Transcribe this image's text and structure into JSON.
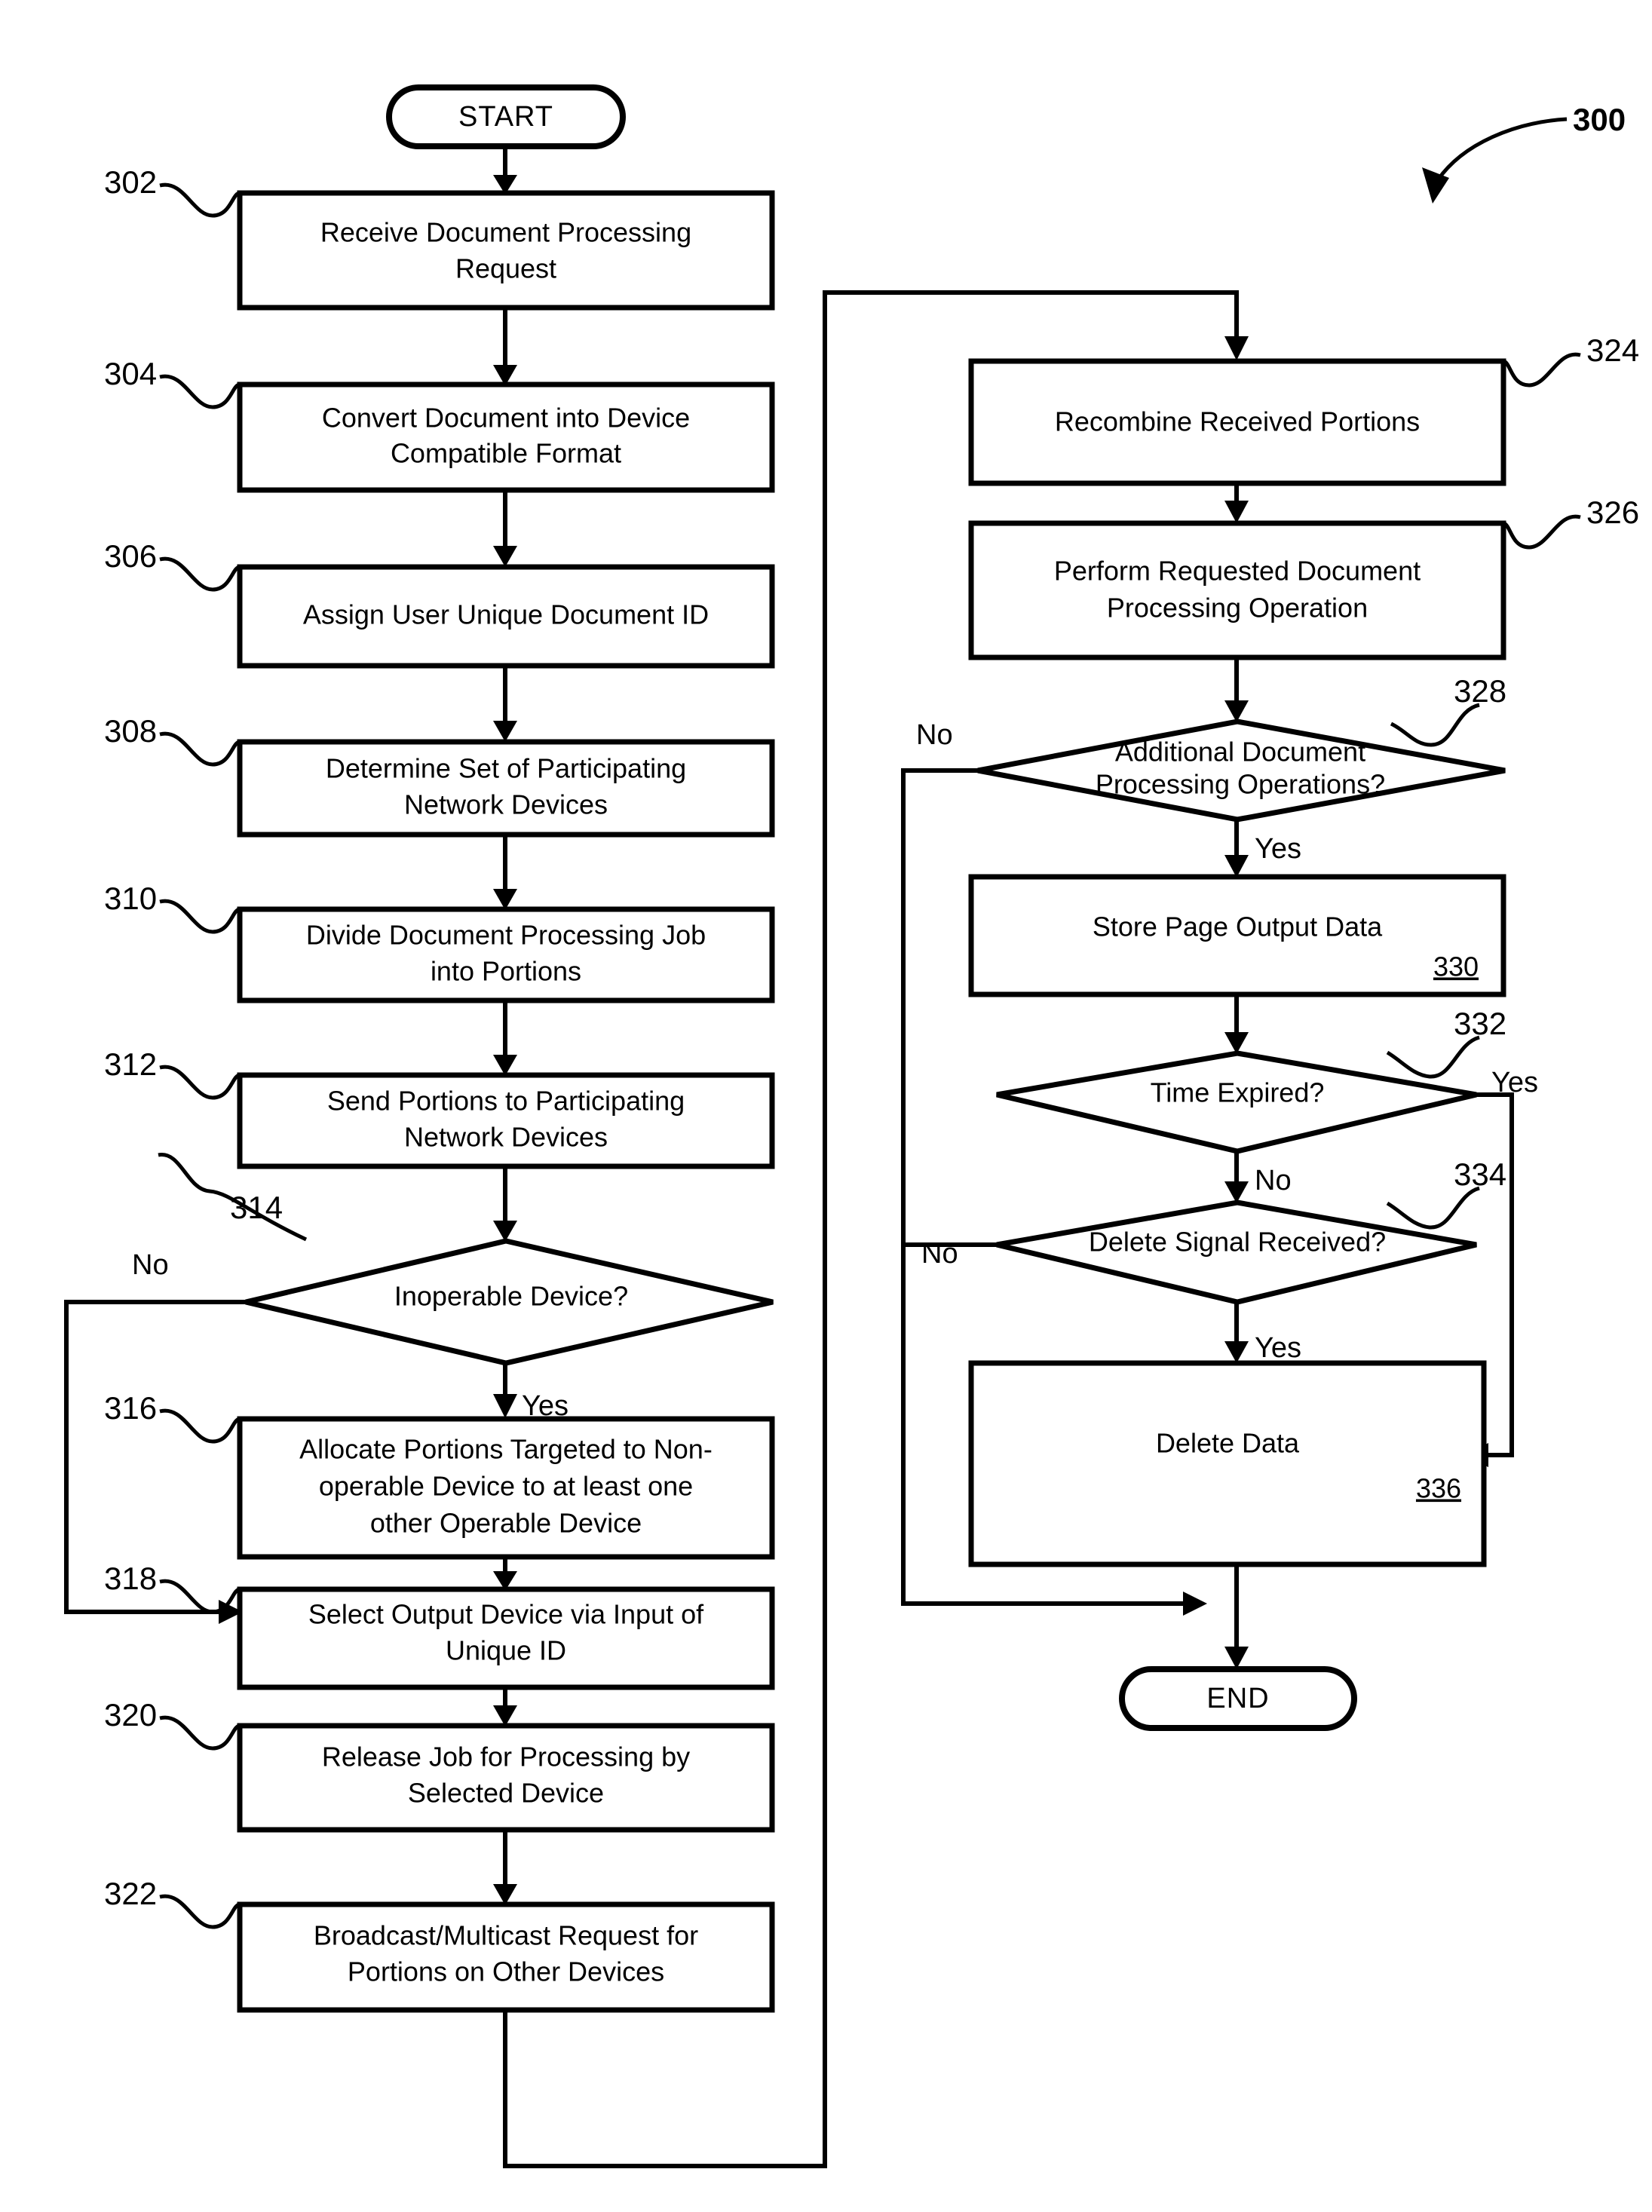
{
  "figure": {
    "reference_numeral": "300"
  },
  "terminators": {
    "start": "START",
    "end": "END"
  },
  "branch_labels": {
    "no": "No",
    "yes": "Yes"
  },
  "steps": [
    {
      "ref": "302",
      "kind": "process",
      "lines": [
        "Receive Document Processing",
        "Request"
      ]
    },
    {
      "ref": "304",
      "kind": "process",
      "lines": [
        "Convert Document into Device",
        "Compatible Format"
      ]
    },
    {
      "ref": "306",
      "kind": "process",
      "lines": [
        "Assign User Unique Document ID"
      ]
    },
    {
      "ref": "308",
      "kind": "process",
      "lines": [
        "Determine Set of Participating",
        "Network Devices"
      ]
    },
    {
      "ref": "310",
      "kind": "process",
      "lines": [
        "Divide Document Processing Job",
        "into Portions"
      ]
    },
    {
      "ref": "312",
      "kind": "process",
      "lines": [
        "Send Portions to Participating",
        "Network Devices"
      ]
    },
    {
      "ref": "314",
      "kind": "decision",
      "lines": [
        "Inoperable Device?"
      ],
      "yes": "Yes",
      "no": "No"
    },
    {
      "ref": "316",
      "kind": "process",
      "lines": [
        "Allocate Portions Targeted to Non-",
        "operable Device to at least one",
        "other Operable Device"
      ]
    },
    {
      "ref": "318",
      "kind": "process",
      "lines": [
        "Select Output Device via Input of",
        "Unique ID"
      ]
    },
    {
      "ref": "320",
      "kind": "process",
      "lines": [
        "Release Job for Processing by",
        "Selected Device"
      ]
    },
    {
      "ref": "322",
      "kind": "process",
      "lines": [
        "Broadcast/Multicast Request for",
        "Portions on Other Devices"
      ]
    },
    {
      "ref": "324",
      "kind": "process",
      "lines": [
        "Recombine Received Portions"
      ]
    },
    {
      "ref": "326",
      "kind": "process",
      "lines": [
        "Perform Requested Document",
        "Processing Operation"
      ]
    },
    {
      "ref": "328",
      "kind": "decision",
      "lines": [
        "Additional Document",
        "Processing Operations?"
      ],
      "yes": "Yes",
      "no": "No"
    },
    {
      "ref": "330",
      "kind": "process",
      "lines": [
        "Store Page Output Data"
      ],
      "inner_ref": "330"
    },
    {
      "ref": "332",
      "kind": "decision",
      "lines": [
        "Time Expired?"
      ],
      "yes": "Yes",
      "no": "No"
    },
    {
      "ref": "334",
      "kind": "decision",
      "lines": [
        "Delete Signal Received?"
      ],
      "yes": "Yes",
      "no": "No"
    },
    {
      "ref": "336",
      "kind": "process",
      "lines": [
        "Delete Data"
      ],
      "inner_ref": "336"
    }
  ],
  "colors": {
    "stroke": "#000000",
    "fill": "#ffffff",
    "text": "#000000"
  }
}
